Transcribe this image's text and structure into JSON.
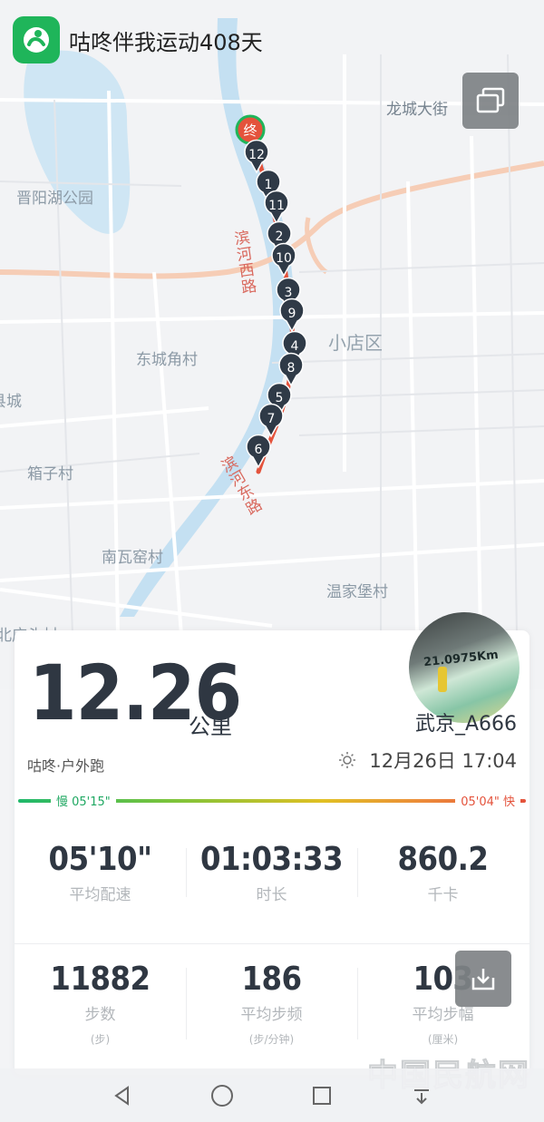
{
  "app": {
    "title": "咕咚伴我运动408天",
    "logo_icon": "gudong-logo-icon",
    "brand_color": "#1fb55a"
  },
  "map": {
    "labels": {
      "longcheng": "龙城大街",
      "jinyanghu": "晋阳湖公园",
      "xiaodian": "小店区",
      "dongcheng": "东城角村",
      "xiang": "箱子村",
      "nanwa": "南瓦窑村",
      "wenjia": "温家堡村",
      "county_partial": "县城",
      "village_partial": "北庄头村",
      "road_west": "滨河西路",
      "road_east": "滨河东路"
    },
    "end_marker": "终",
    "km_markers": [
      "12",
      "1",
      "11",
      "2",
      "10",
      "3",
      "9",
      "4",
      "8",
      "5",
      "7",
      "6"
    ],
    "route_color": "#e4533c"
  },
  "summary": {
    "distance": "12.26",
    "distance_unit": "公里",
    "username": "武京_A666",
    "avatar_text": "21.0975Km",
    "activity_type": "咕咚·户外跑",
    "date": "12月26日 17:04",
    "pace_slow": "慢 05'15\"",
    "pace_fast": "05'04\" 快"
  },
  "stats": [
    {
      "value": "05'10\"",
      "label": "平均配速"
    },
    {
      "value": "01:03:33",
      "label": "时长"
    },
    {
      "value": "860.2",
      "label": "千卡"
    },
    {
      "value": "11882",
      "label": "步数",
      "unit": "(步)"
    },
    {
      "value": "186",
      "label": "平均步频",
      "unit": "(步/分钟)"
    },
    {
      "value": "103",
      "label": "平均步幅",
      "unit": "(厘米)"
    }
  ],
  "watermark": "中国民航网"
}
